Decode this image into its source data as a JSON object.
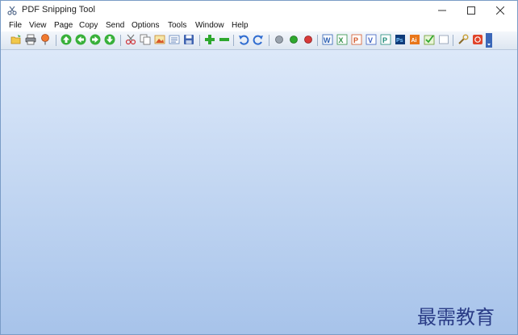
{
  "window": {
    "title": "PDF Snipping Tool"
  },
  "menu": [
    "File",
    "View",
    "Page",
    "Copy",
    "Send",
    "Options",
    "Tools",
    "Window",
    "Help"
  ],
  "watermark": {
    "text": "最需教育"
  },
  "toolbar_icons": [
    "open-icon",
    "print-icon",
    "pin-icon",
    "up-arrow-icon",
    "left-arrow-icon",
    "right-arrow-icon",
    "down-arrow-icon",
    "cut-icon",
    "copy-icon",
    "snip-image-icon",
    "snip-text-icon",
    "save-icon",
    "add-icon",
    "remove-icon",
    "undo-icon",
    "redo-icon",
    "light-gray-icon",
    "light-green-icon",
    "light-red-icon",
    "word-icon",
    "excel-icon",
    "powerpoint-icon",
    "visio-icon",
    "publisher-icon",
    "photoshop-icon",
    "illustrator-icon",
    "accept-icon",
    "blank-icon",
    "settings-icon",
    "exit-icon"
  ]
}
